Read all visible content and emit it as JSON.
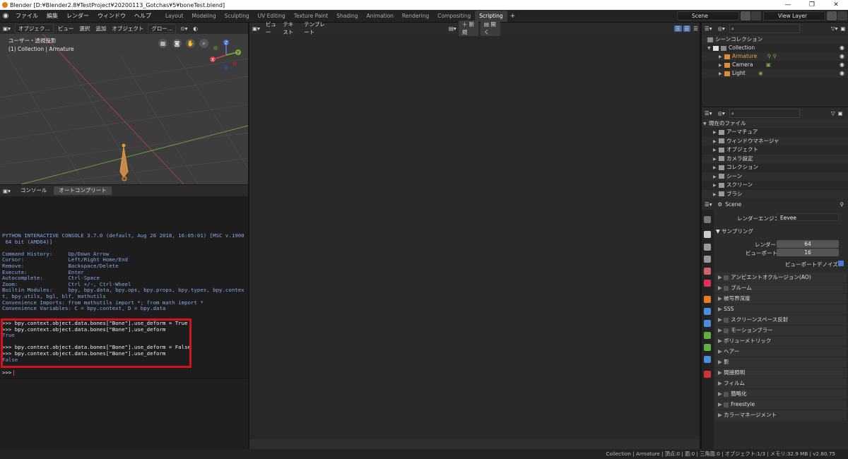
{
  "window": {
    "title": "Blender [D:¥Blender2.8¥TestProject¥20200113_Gotchas¥5¥boneTest.blend]",
    "buttons": [
      "—",
      "❐",
      "✕"
    ]
  },
  "topbar": {
    "menu": [
      "ファイル",
      "編集",
      "レンダー",
      "ウィンドウ",
      "ヘルプ"
    ],
    "tabs": [
      "Layout",
      "Modeling",
      "Sculpting",
      "UV Editing",
      "Texture Paint",
      "Shading",
      "Animation",
      "Rendering",
      "Compositing",
      "Scripting"
    ],
    "active_tab": "Scripting",
    "plus": "+",
    "scene": "Scene",
    "view_layer": "View Layer"
  },
  "viewport": {
    "header": [
      "オブジェク…",
      "ビュー",
      "選択",
      "追加",
      "オブジェクト",
      "グロー…"
    ],
    "view_name": "ユーザー・透視投影",
    "collection_info": "(1) Collection | Armature",
    "gizmo": {
      "z": "Z",
      "y": "Y",
      "x": "X"
    }
  },
  "console": {
    "tabs": [
      "コンソール",
      "オートコンプリート"
    ],
    "active_tab": "オートコンプリート",
    "banner": [
      "PYTHON INTERACTIVE CONSOLE 3.7.0 (default, Aug 26 2018, 16:05:01) [MSC v.1900",
      " 64 bit (AMD64)]",
      "",
      "Command History:     Up/Down Arrow",
      "Cursor:              Left/Right Home/End",
      "Remove:              Backspace/Delete",
      "Execute:             Enter",
      "Autocomplete:        Ctrl-Space",
      "Zoom:                Ctrl +/-, Ctrl-Wheel",
      "Builtin Modules:     bpy, bpy.data, bpy.ops, bpy.props, bpy.types, bpy.contex",
      "t, bpy.utils, bgl, blf, mathutils",
      "Convenience Imports: from mathutils import *; from math import *",
      "Convenience Variables: C = bpy.context, D = bpy.data"
    ],
    "session": [
      {
        "text": ">>> bpy.context.object.data.bones[\"Bone\"].use_deform = True",
        "kind": "out"
      },
      {
        "text": ">>> bpy.context.object.data.bones[\"Bone\"].use_deform",
        "kind": "out"
      },
      {
        "text": "True",
        "kind": "res"
      },
      {
        "text": "",
        "kind": "out"
      },
      {
        "text": ">>> bpy.context.object.data.bones[\"Bone\"].use_deform = False",
        "kind": "out"
      },
      {
        "text": ">>> bpy.context.object.data.bones[\"Bone\"].use_deform",
        "kind": "out"
      },
      {
        "text": "False",
        "kind": "res"
      }
    ],
    "prompt": ">>> "
  },
  "text_editor": {
    "header": [
      "ビュー",
      "テキスト",
      "テンプレート"
    ],
    "new_label": "新規",
    "open_label": "開く"
  },
  "outliner": {
    "root": "シーンコレクション",
    "items": [
      {
        "label": "Collection",
        "color": "#dddddd"
      },
      {
        "label": "Armature",
        "color": "#e8a24a"
      },
      {
        "label": "Camera",
        "color": "#dddddd"
      },
      {
        "label": "Light",
        "color": "#dddddd"
      }
    ]
  },
  "file_outliner": {
    "root": "現在のファイル",
    "items": [
      "アーマチュア",
      "ウィンドウマネージャ",
      "オブジェクト",
      "カメラ設定",
      "コレクション",
      "シーン",
      "スクリーン",
      "ブラシ"
    ]
  },
  "properties": {
    "scene": "Scene",
    "render_engine_label": "レンダーエンジン",
    "render_engine": "Eevee",
    "sampling": "サンプリング",
    "render_label": "レンダー",
    "render_value": "64",
    "viewport_label": "ビューポート",
    "viewport_value": "16",
    "denoise_label": "ビューポートデノイズ",
    "panels": [
      {
        "label": "アンビエントオクルージョン(AO)",
        "check": true
      },
      {
        "label": "ブルーム",
        "check": true
      },
      {
        "label": "被写界深度",
        "check": false
      },
      {
        "label": "SSS",
        "check": false
      },
      {
        "label": "スクリーンスペース反射",
        "check": true
      },
      {
        "label": "モーションブラー",
        "check": true
      },
      {
        "label": "ボリューメトリック",
        "check": false
      },
      {
        "label": "ヘアー",
        "check": false
      },
      {
        "label": "影",
        "check": false
      },
      {
        "label": "間接照明",
        "check": false
      },
      {
        "label": "フィルム",
        "check": false
      },
      {
        "label": "簡略化",
        "check": true
      },
      {
        "label": "Freestyle",
        "check": true
      },
      {
        "label": "カラーマネージメント",
        "check": false
      }
    ]
  },
  "status": "Collection | Armature | 頂点:0 | 面:0 | 三角面:0 | オブジェクト:1/3 | メモリ:32.9 MB | v2.80.75"
}
